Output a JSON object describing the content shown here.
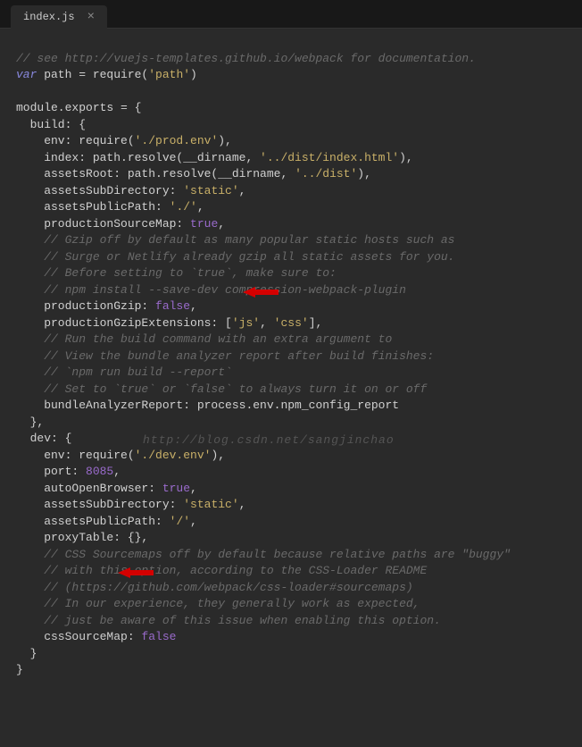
{
  "tab": {
    "name": "index.js",
    "close": "×"
  },
  "code": {
    "l1_comment": "// see http://vuejs-templates.github.io/webpack for documentation.",
    "var": "var",
    "path": " path = require(",
    "path_str": "'path'",
    "close_paren": ")",
    "module_exports": "module.exports = {",
    "build_label": "  build: {",
    "env_build": "    env: require(",
    "env_build_str": "'./prod.env'",
    "index_label": "    index: path.resolve(__dirname, ",
    "index_str": "'../dist/index.html'",
    "assetsRoot_label": "    assetsRoot: path.resolve(__dirname, ",
    "assetsRoot_str": "'../dist'",
    "assetsSubDir_label": "    assetsSubDirectory: ",
    "assetsSubDir_str": "'static'",
    "assetsPublic_label": "    assetsPublicPath: ",
    "assetsPublic_str": "'./'",
    "prodSrcMap_label": "    productionSourceMap: ",
    "true": "true",
    "false": "false",
    "c_gzip1": "    // Gzip off by default as many popular static hosts such as",
    "c_gzip2": "    // Surge or Netlify already gzip all static assets for you.",
    "c_gzip3": "    // Before setting to `true`, make sure to:",
    "c_gzip4": "    // npm install --save-dev compression-webpack-plugin",
    "prodGzip_label": "    productionGzip: ",
    "prodGzipExt_label": "    productionGzipExtensions: [",
    "js_str": "'js'",
    "css_str": "'css'",
    "close_bracket": "],",
    "c_run1": "    // Run the build command with an extra argument to",
    "c_run2": "    // View the bundle analyzer report after build finishes:",
    "c_run3": "    // `npm run build --report`",
    "c_run4": "    // Set to `true` or `false` to always turn it on or off",
    "bundleReport": "    bundleAnalyzerReport: process.env.npm_config_report",
    "close_build": "  },",
    "dev_label": "  dev: {",
    "env_dev": "    env: require(",
    "env_dev_str": "'./dev.env'",
    "port_label": "    port: ",
    "port_num": "8085",
    "autoOpen_label": "    autoOpenBrowser: ",
    "assetsSubDir2_label": "    assetsSubDirectory: ",
    "assetsPublic2_label": "    assetsPublicPath: ",
    "assetsPublic2_str": "'/'",
    "proxy_label": "    proxyTable: {},",
    "c_css1": "    // CSS Sourcemaps off by default because relative paths are \"buggy\"",
    "c_css2": "    // with this option, according to the CSS-Loader README",
    "c_css3": "    // (https://github.com/webpack/css-loader#sourcemaps)",
    "c_css4": "    // In our experience, they generally work as expected,",
    "c_css5": "    // just be aware of this issue when enabling this option.",
    "cssSrcMap_label": "    cssSourceMap: ",
    "close_dev": "  }",
    "close_module": "}"
  },
  "comma": ",",
  "comma_space": ", ",
  "close_paren_comma": "),",
  "watermark": "http://blog.csdn.net/sangjinchao"
}
